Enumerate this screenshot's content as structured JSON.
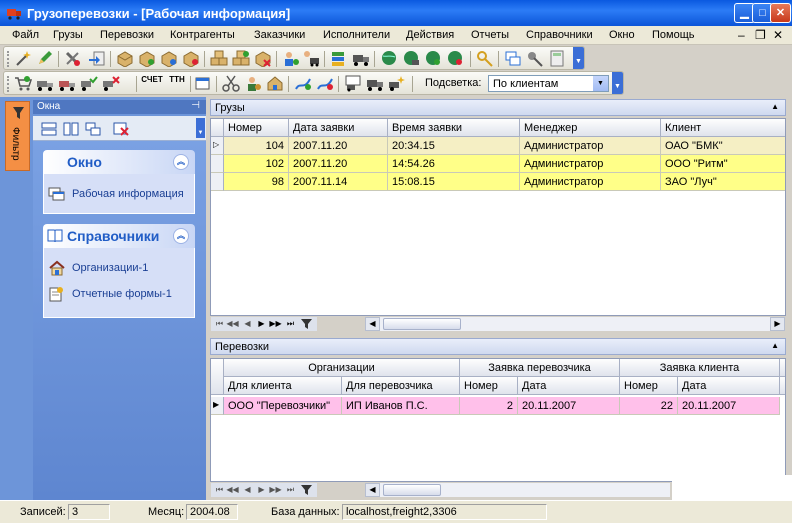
{
  "window": {
    "title": "Грузоперевозки - [Рабочая информация]"
  },
  "menu": [
    "Файл",
    "Грузы",
    "Перевозки",
    "Контрагенты",
    "Заказчики",
    "Исполнители",
    "Действия",
    "Отчеты",
    "Справочники",
    "Окно",
    "Помощь"
  ],
  "toolbar2": {
    "btn_a": "СЧЕТ",
    "btn_b": "ТТН",
    "highlight_label": "Подсветка:",
    "highlight_value": "По клиентам"
  },
  "left_panel": {
    "filter_tab": "Фильтр",
    "dock_title": "Окна",
    "groups": [
      {
        "title": "Окно",
        "items": [
          "Рабочая информация"
        ]
      },
      {
        "title": "Справочники",
        "items": [
          "Организации-1",
          "Отчетные формы-1"
        ]
      }
    ]
  },
  "cargo": {
    "title": "Грузы",
    "columns": [
      "Номер",
      "Дата заявки",
      "Время заявки",
      "Менеджер",
      "Клиент"
    ],
    "rows": [
      [
        "104",
        "2007.11.20",
        "20:34.15",
        "Администратор",
        "ОАО \"БМК\""
      ],
      [
        "102",
        "2007.11.20",
        "14:54.26",
        "Администратор",
        "ООО \"Ритм\""
      ],
      [
        "98",
        "2007.11.14",
        "15:08.15",
        "Администратор",
        "ЗАО \"Луч\""
      ]
    ]
  },
  "transport": {
    "title": "Перевозки",
    "group_headers": [
      "Организации",
      "Заявка перевозчика",
      "Заявка клиента"
    ],
    "columns": [
      "Для клиента",
      "Для перевозчика",
      "Номер",
      "Дата",
      "Номер",
      "Дата"
    ],
    "rows": [
      [
        "ООО \"Перевозчики\"",
        "ИП Иванов П.С.",
        "2",
        "20.11.2007",
        "22",
        "20.11.2007"
      ]
    ]
  },
  "status": {
    "records_label": "Записей:",
    "records_value": "3",
    "month_label": "Месяц:",
    "month_value": "2004.08",
    "db_label": "База данных:",
    "db_value": "localhost,freight2,3306"
  },
  "colors": {
    "accent": "#0a59e0",
    "row_selected": "#f5efc4",
    "row_highlight": "#ffff88",
    "row_pink": "#ffc0ea",
    "taskpane": "#6d95d9",
    "filter_tab": "#f48f44"
  }
}
